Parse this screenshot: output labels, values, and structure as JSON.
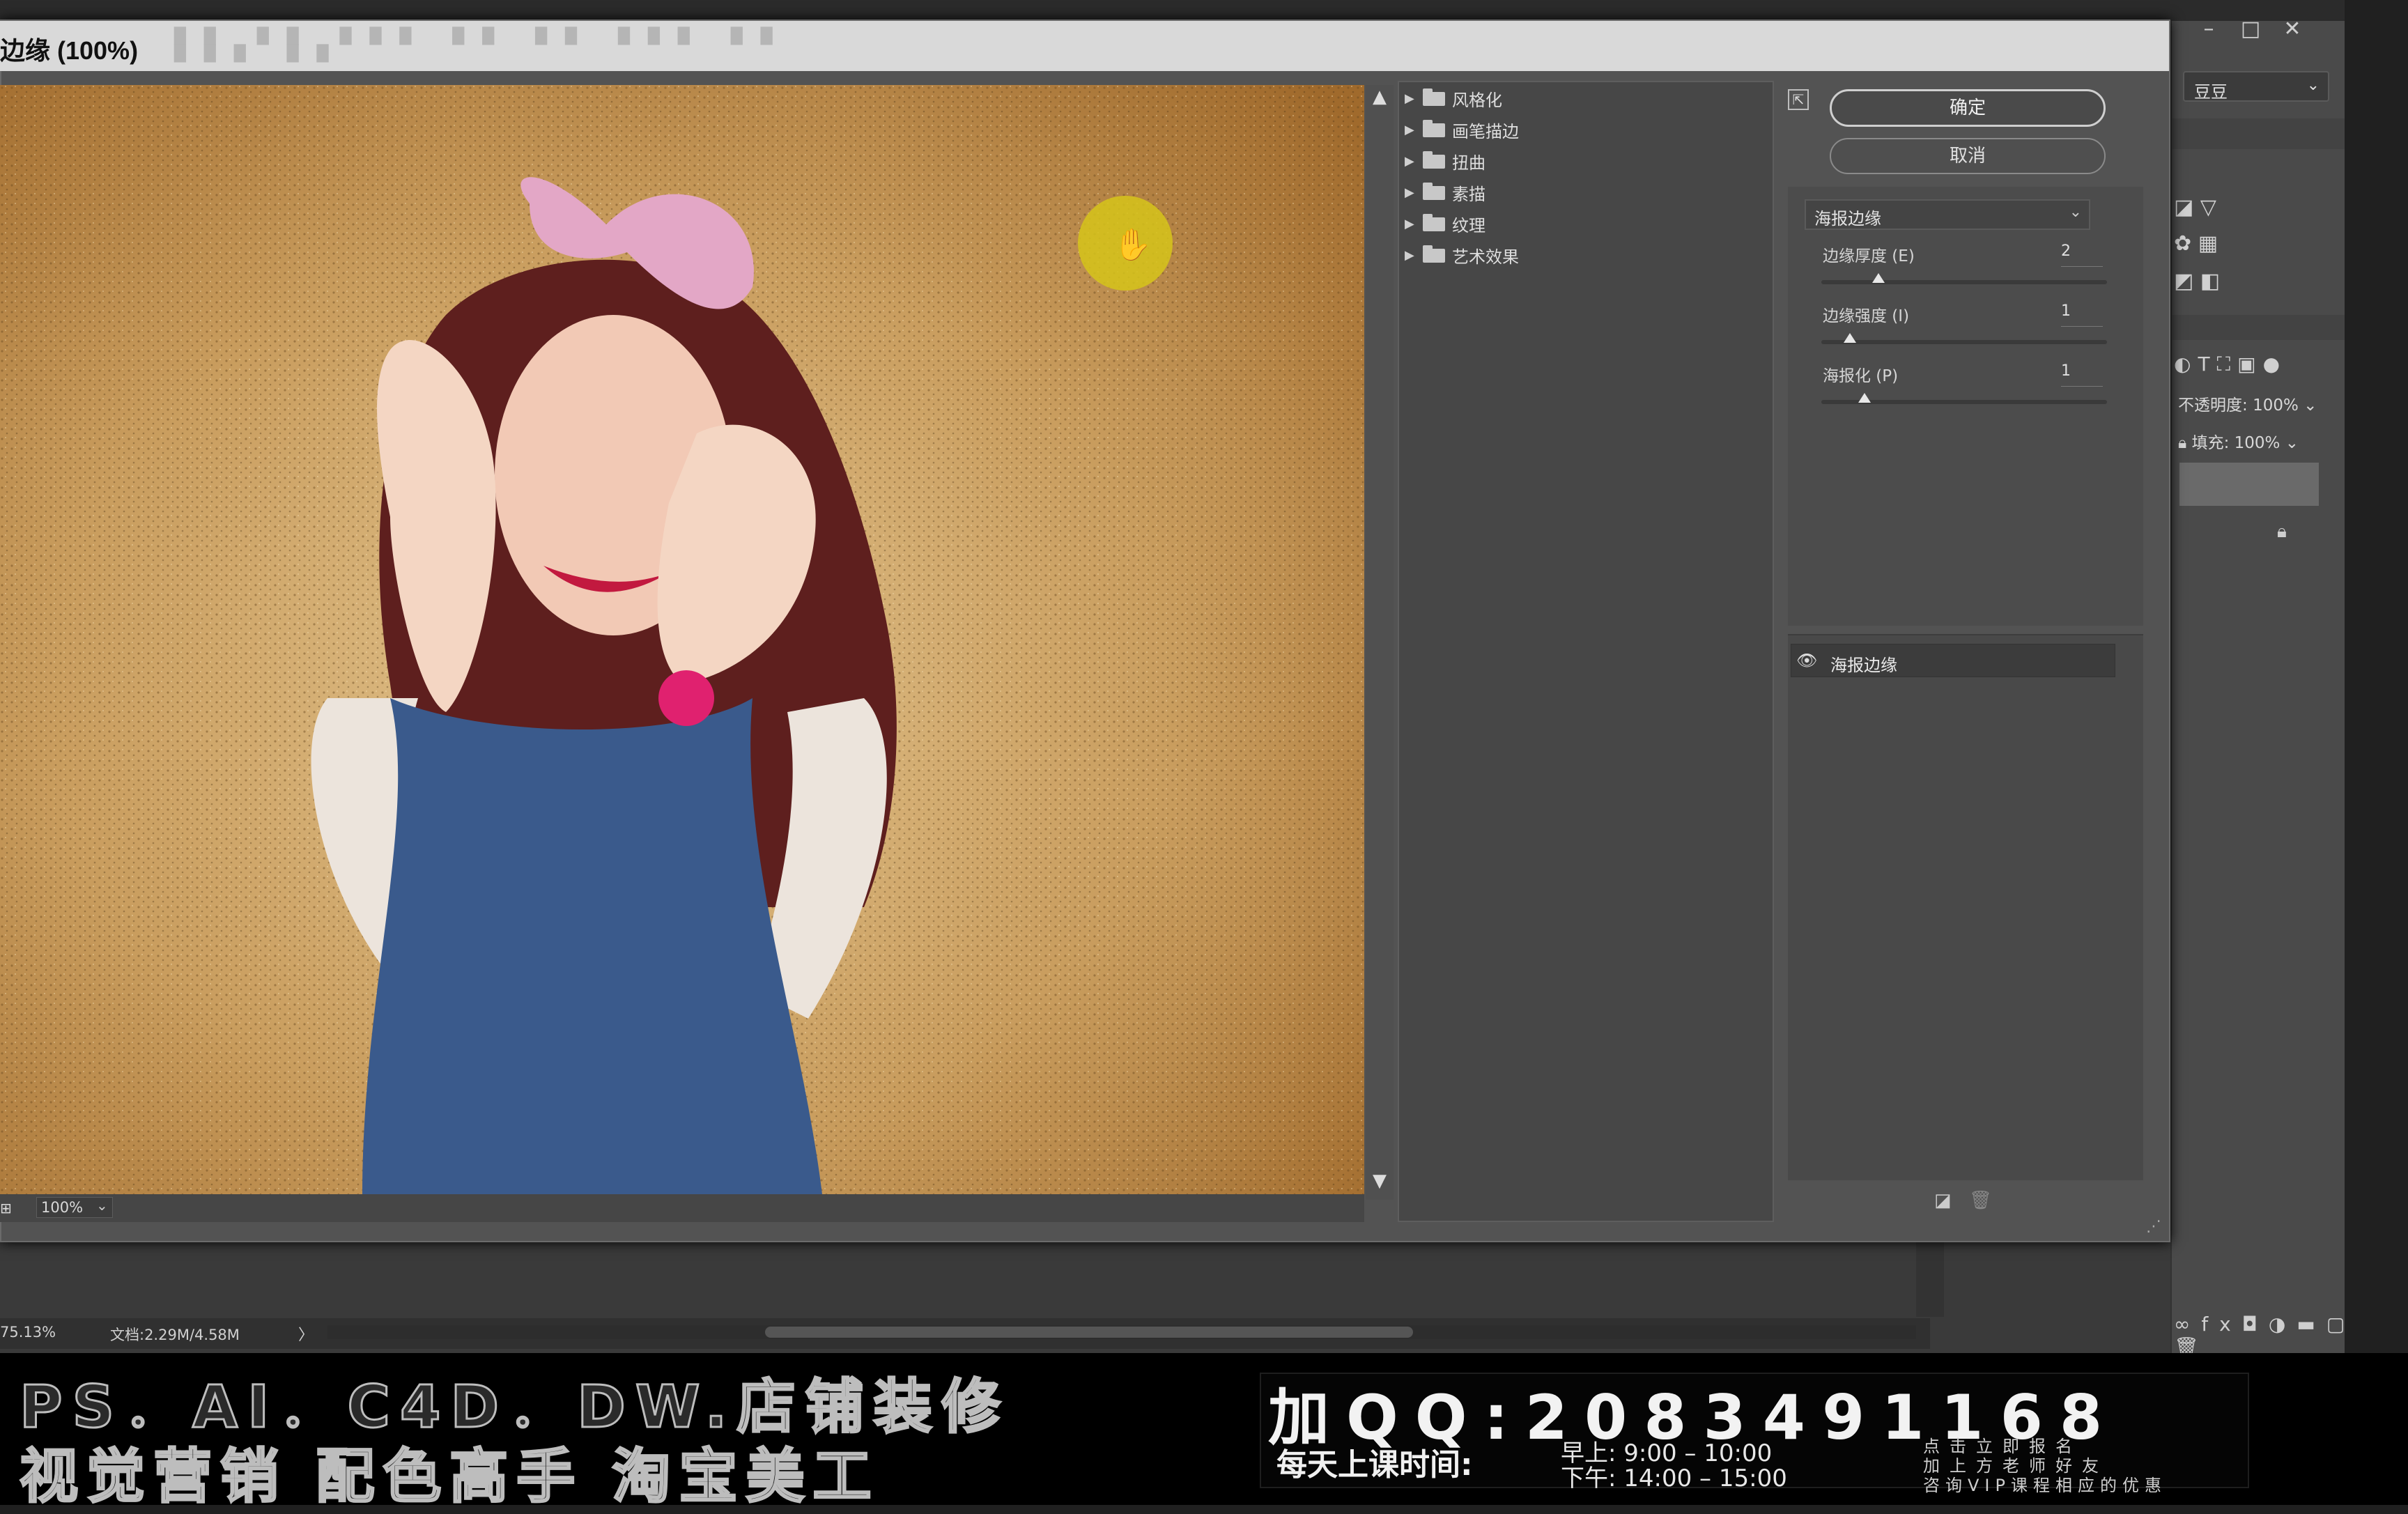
{
  "window": {
    "title": "边缘 (100%)",
    "controls": {
      "minimize": "–",
      "restore": "□",
      "close": "✕"
    },
    "title_bar_blurred_menu": "██ ██ ███ ██ ██ ███ ██ ███ ██"
  },
  "dialog": {
    "ok_label": "确定",
    "cancel_label": "取消",
    "collapse_icon": "⇱",
    "filter_folders": [
      {
        "label": "风格化"
      },
      {
        "label": "画笔描边"
      },
      {
        "label": "扭曲"
      },
      {
        "label": "素描"
      },
      {
        "label": "纹理"
      },
      {
        "label": "艺术效果"
      }
    ],
    "selected_filter": "海报边缘",
    "params": [
      {
        "label": "边缘厚度 (E)",
        "value": "2",
        "fraction": 0.2
      },
      {
        "label": "边缘强度 (I)",
        "value": "1",
        "fraction": 0.1
      },
      {
        "label": "海报化 (P)",
        "value": "1",
        "fraction": 0.15
      }
    ],
    "effect_layer": "海报边缘",
    "zoom": "100%"
  },
  "workspace": {
    "preset": "豆豆",
    "opacity_label": "不透明度:",
    "opacity_value": "100%",
    "fill_label": "填充:",
    "fill_value": "100%"
  },
  "status": {
    "zoom": "75.13%",
    "doc": "文档:2.29M/4.58M",
    "arrow": "〉"
  },
  "ad": {
    "line1": "PS．AI．C4D．DW.店铺装修",
    "line2": "视觉营销  配色高手  淘宝美工",
    "qq": "加QQ:2083491168",
    "schedule_label": "每天上课时间:",
    "time_am": "早上: 9:00 – 10:00",
    "time_pm": "下午: 14:00 – 15:00",
    "promo1": "点击立即报名",
    "promo2": "加上方老师好友",
    "promo3": "咨询VIP课程相应的优惠"
  },
  "colors": {
    "preview_bg": "#b88d4d",
    "dialog_bg": "#535353",
    "cursor_highlight": "#d6c41a"
  }
}
